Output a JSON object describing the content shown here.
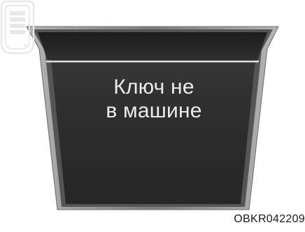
{
  "display": {
    "message_line1": "Ключ не",
    "message_line2": "в машине",
    "icon": "smart-key-icon"
  },
  "caption": {
    "code": "OBKR042209"
  },
  "colors": {
    "screen": "#2b2b2b",
    "bezel_outer": "#8f8f8f",
    "bezel_inner": "#5c5c5c",
    "text": "#ededed",
    "separator": "#e0e0e0"
  }
}
